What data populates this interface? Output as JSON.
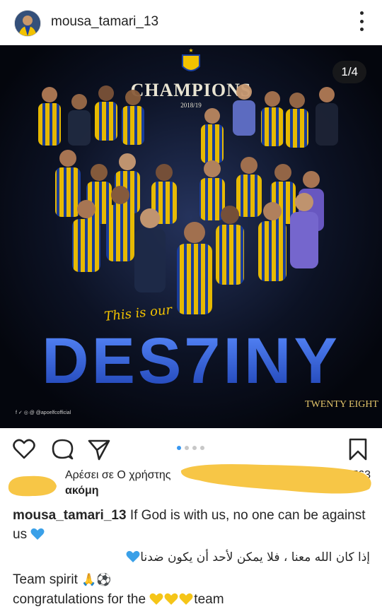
{
  "header": {
    "username": "mousa_tamari_13"
  },
  "post": {
    "counter": "1/4",
    "image_text": {
      "champions": "CHAMPIONS",
      "season": "2018/19",
      "this_is_our": "This is our",
      "destiny": "DES7INY",
      "brand": "TWENTY EIGHT",
      "social": "f ✓ ◎ @ @apoelfcofficial"
    }
  },
  "actions": {
    "icons": [
      "heart-icon",
      "comment-icon",
      "share-icon",
      "bookmark-icon"
    ],
    "pages": 4,
    "active_page": 1
  },
  "likes": {
    "line1": "Αρέσει σε Ο χρήστης ",
    "line2": "ακόμη",
    "partial_count": "7 763"
  },
  "caption": {
    "username": "mousa_tamari_13",
    "text1": " If God is with us, no one can be against us ",
    "arabic": "إذا كان الله معنا ، فلا يمكن لأحد أن يكون ضدنا",
    "text2": "Team spirit ",
    "text2_emoji": "🙏⚽",
    "text3_pre": "congratulations for the ",
    "text3_post": "team"
  },
  "colors": {
    "accent_blue": "#3897f0",
    "apoel_yellow": "#f2c200",
    "apoel_blue": "#1a3fa0",
    "highlight_scribble": "#f7c646"
  }
}
